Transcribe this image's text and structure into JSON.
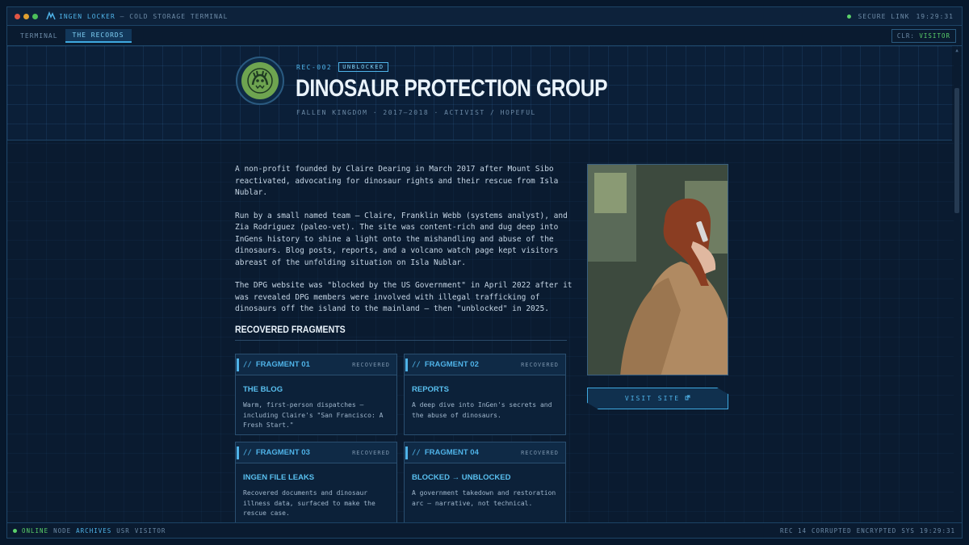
{
  "titlebar": {
    "app_name": "INGEN LOCKER",
    "window_title": "— COLD STORAGE TERMINAL",
    "secure_link": "SECURE LINK",
    "time": "19:29:31"
  },
  "nav": {
    "items": [
      {
        "label": "TERMINAL"
      },
      {
        "label": "THE RECORDS"
      }
    ],
    "clearance_label": "CLR:",
    "clearance_value": "VISITOR"
  },
  "record": {
    "id": "REC-002",
    "status": "UNBLOCKED",
    "title": "DINOSAUR PROTECTION GROUP",
    "subtitle": "FALLEN KINGDOM · 2017–2018 · ACTIVIST / HOPEFUL"
  },
  "body": {
    "paragraphs": [
      "A non-profit founded by Claire Dearing in March 2017 after Mount Sibo reactivated, advocating for dinosaur rights and their rescue from Isla Nublar.",
      "Run by a small named team — Claire, Franklin Webb (systems analyst), and Zia Rodriguez (paleo-vet). The site was content-rich and dug deep into InGens history to shine a light onto the mishandling and abuse of the dinosaurs. Blog posts, reports, and a volcano watch page kept visitors abreast of the unfolding situation on Isla Nublar.",
      "The DPG website was \"blocked by the US Government\" in April 2022 after it was revealed DPG members were involved with illegal trafficking of dinosaurs off the island to the mainland — then \"unblocked\" in 2025."
    ]
  },
  "fragments": {
    "heading": "RECOVERED FRAGMENTS",
    "items": [
      {
        "name": "FRAGMENT 01",
        "status": "RECOVERED",
        "title": "THE BLOG",
        "body": "Warm, first-person dispatches — including Claire's \"San Francisco: A Fresh Start.\""
      },
      {
        "name": "FRAGMENT 02",
        "status": "RECOVERED",
        "title": "REPORTS",
        "body": "A deep dive into InGen's secrets and the abuse of dinosaurs."
      },
      {
        "name": "FRAGMENT 03",
        "status": "RECOVERED",
        "title": "INGEN FILE LEAKS",
        "body": "Recovered documents and dinosaur illness data, surfaced to make the rescue case."
      },
      {
        "name": "FRAGMENT 04",
        "status": "RECOVERED",
        "title": "BLOCKED → UNBLOCKED",
        "body": "A government takedown and restoration arc — narrative, not technical."
      }
    ]
  },
  "sidebar": {
    "visit_label": "VISIT SITE"
  },
  "statusbar": {
    "online": "ONLINE",
    "node_label": "NODE",
    "node_value": "ARCHIVES",
    "usr_label": "USR",
    "usr_value": "VISITOR",
    "rec_label": "REC 14",
    "rec_state": "CORRUPTED",
    "encryption": "ENCRYPTED",
    "sys_label": "SYS",
    "sys_time": "19:29:31"
  },
  "colors": {
    "accent": "#4fb3e8",
    "online": "#5bd16a",
    "background": "#0a1b30"
  }
}
